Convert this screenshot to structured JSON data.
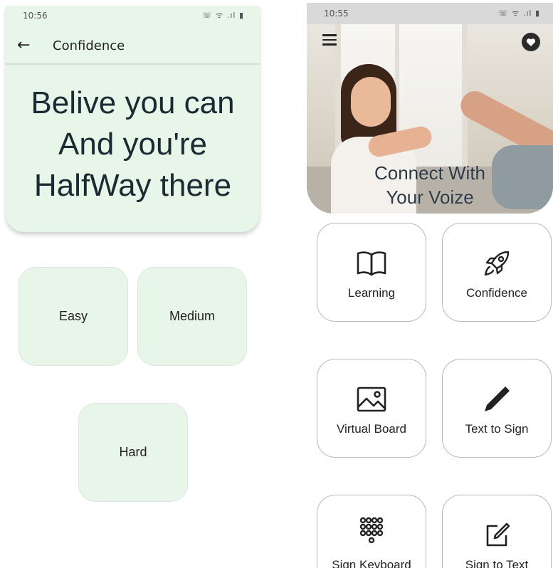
{
  "left_screen": {
    "status_bar": {
      "time": "10:56",
      "icons": "☏ ᯤ .ıl ▮"
    },
    "toolbar": {
      "back_icon": "arrow-left",
      "title": "Confidence"
    },
    "quote_lines": [
      "Belive you can",
      "And you're",
      "HalfWay there"
    ],
    "levels": [
      {
        "label": "Easy"
      },
      {
        "label": "Medium"
      },
      {
        "label": "Hard"
      }
    ],
    "colors": {
      "header_bg": "#e8f5e9",
      "button_bg": "#e8f5e9",
      "text": "#1c2b33"
    }
  },
  "right_screen": {
    "status_bar": {
      "time": "10:55",
      "icons": "☏ ᯤ .ıl ▮"
    },
    "header": {
      "menu_icon": "hamburger-menu",
      "favorite_icon": "heart",
      "title_lines": [
        "Connect With",
        "Your Voize"
      ]
    },
    "features": [
      {
        "label": "Learning",
        "icon": "open-book"
      },
      {
        "label": "Confidence",
        "icon": "rocket"
      },
      {
        "label": "Virtual Board",
        "icon": "image"
      },
      {
        "label": "Text to Sign",
        "icon": "pen"
      },
      {
        "label": "Sign Keyboard",
        "icon": "keypad"
      },
      {
        "label": "Sign to Text",
        "icon": "edit-square"
      }
    ]
  }
}
